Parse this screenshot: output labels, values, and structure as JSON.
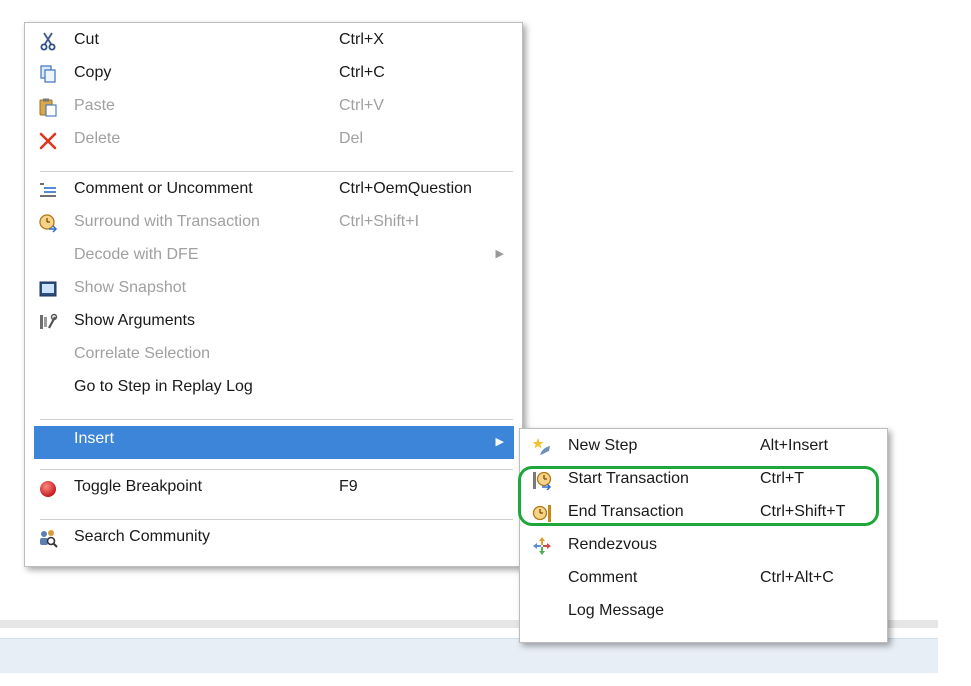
{
  "context_menu": {
    "items": [
      {
        "label": "Cut",
        "shortcut": "Ctrl+X",
        "icon": "scissors-icon",
        "enabled": true
      },
      {
        "label": "Copy",
        "shortcut": "Ctrl+C",
        "icon": "copy-icon",
        "enabled": true
      },
      {
        "label": "Paste",
        "shortcut": "Ctrl+V",
        "icon": "paste-icon",
        "enabled": false
      },
      {
        "label": "Delete",
        "shortcut": "Del",
        "icon": "delete-icon",
        "enabled": false
      },
      {
        "label": "Comment or Uncomment",
        "shortcut": "Ctrl+OemQuestion",
        "icon": "comment-lines-icon",
        "enabled": true
      },
      {
        "label": "Surround with Transaction",
        "shortcut": "Ctrl+Shift+I",
        "icon": "transaction-clock-icon",
        "enabled": false
      },
      {
        "label": "Decode with DFE",
        "shortcut": "",
        "icon": "",
        "enabled": false,
        "has_submenu": true
      },
      {
        "label": "Show Snapshot",
        "shortcut": "",
        "icon": "snapshot-icon",
        "enabled": false
      },
      {
        "label": "Show Arguments",
        "shortcut": "",
        "icon": "arguments-icon",
        "enabled": true
      },
      {
        "label": "Correlate Selection",
        "shortcut": "",
        "icon": "",
        "enabled": false
      },
      {
        "label": "Go to Step in Replay Log",
        "shortcut": "",
        "icon": "",
        "enabled": true
      },
      {
        "label": "Insert",
        "shortcut": "",
        "icon": "",
        "enabled": true,
        "has_submenu": true,
        "highlighted": true
      },
      {
        "label": "Toggle Breakpoint",
        "shortcut": "F9",
        "icon": "breakpoint-icon",
        "enabled": true
      },
      {
        "label": "Search Community",
        "shortcut": "",
        "icon": "community-search-icon",
        "enabled": true
      }
    ]
  },
  "insert_submenu": {
    "items": [
      {
        "label": "New Step",
        "shortcut": "Alt+Insert",
        "icon": "new-step-icon"
      },
      {
        "label": "Start Transaction",
        "shortcut": "Ctrl+T",
        "icon": "start-transaction-icon"
      },
      {
        "label": "End Transaction",
        "shortcut": "Ctrl+Shift+T",
        "icon": "end-transaction-icon"
      },
      {
        "label": "Rendezvous",
        "shortcut": "",
        "icon": "rendezvous-icon"
      },
      {
        "label": "Comment",
        "shortcut": "Ctrl+Alt+C",
        "icon": ""
      },
      {
        "label": "Log Message",
        "shortcut": "",
        "icon": ""
      }
    ]
  },
  "colors": {
    "highlight": "#3d85d9",
    "annotation_outline": "#1ea83c",
    "disabled_text": "#a0a0a0"
  }
}
